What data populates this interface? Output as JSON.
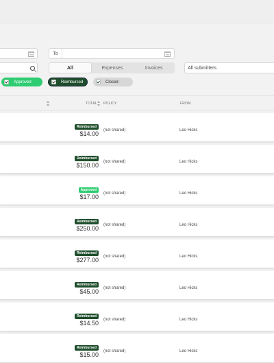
{
  "filters": {
    "to_label": "To",
    "segments": [
      "All",
      "Expenses",
      "Invoices"
    ],
    "submitters_value": "All submitters",
    "status_pills": [
      {
        "label": "Approved",
        "color": "#2ecc71"
      },
      {
        "label": "Reimbursed",
        "color": "#1e4d2b"
      },
      {
        "label": "Closed",
        "color": "#d7d7d7"
      }
    ]
  },
  "table": {
    "headers": {
      "total": "TOTAL",
      "policy": "POLICY",
      "from": "FROM"
    },
    "rows": [
      {
        "status": "Reimbursed",
        "amount": "$14.00",
        "policy": "(not shared)",
        "from": "Leo Hicks"
      },
      {
        "status": "Reimbursed",
        "amount": "$150.00",
        "policy": "(not shared)",
        "from": "Leo Hicks"
      },
      {
        "status": "Approved",
        "amount": "$17.00",
        "policy": "(not shared)",
        "from": "Leo Hicks"
      },
      {
        "status": "Reimbursed",
        "amount": "$250.00",
        "policy": "(not shared)",
        "from": "Leo Hicks"
      },
      {
        "status": "Reimbursed",
        "amount": "$277.00",
        "policy": "(not shared)",
        "from": "Leo Hicks"
      },
      {
        "status": "Reimbursed",
        "amount": "$45.00",
        "policy": "(not shared)",
        "from": "Leo Hicks"
      },
      {
        "status": "Reimbursed",
        "amount": "$14.50",
        "policy": "(not shared)",
        "from": "Leo Hicks"
      },
      {
        "status": "Reimbursed",
        "amount": "$15.00",
        "policy": "(not shared)",
        "from": "Leo Hicks"
      }
    ]
  }
}
